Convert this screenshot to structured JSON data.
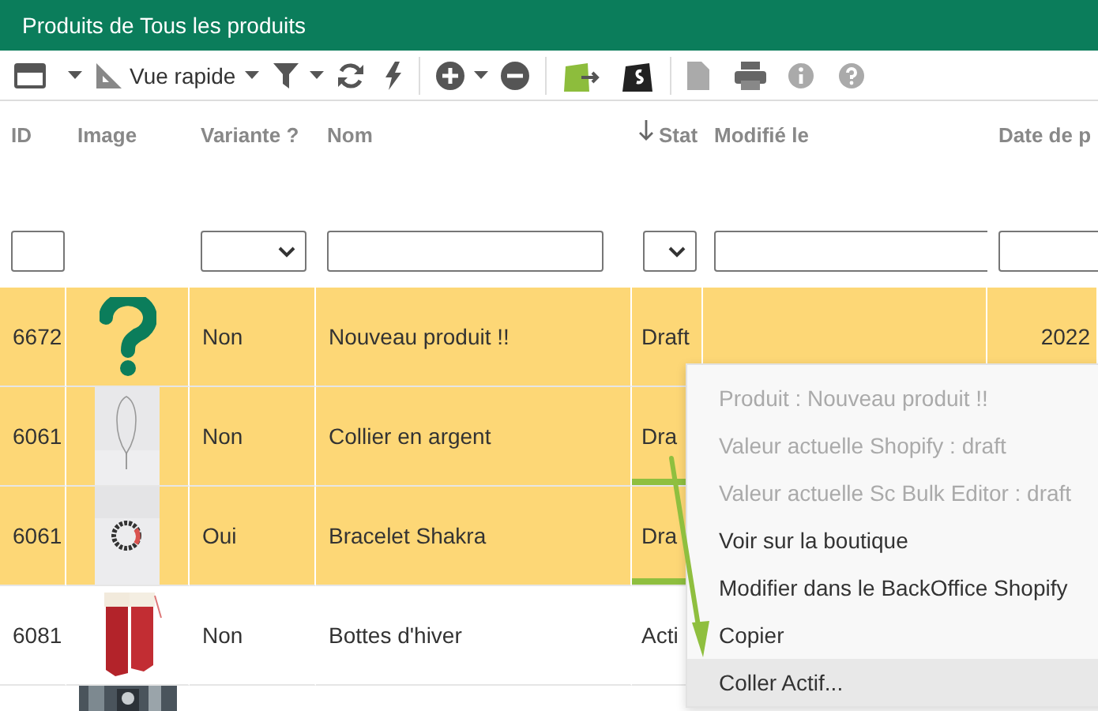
{
  "window": {
    "title": "Produits de Tous les produits"
  },
  "toolbar": {
    "view_label": "Vue rapide"
  },
  "columns": [
    {
      "label": "ID",
      "filter": {
        "kind": "text"
      },
      "sorted": false
    },
    {
      "label": "Image",
      "filter": {
        "kind": "none"
      },
      "sorted": false
    },
    {
      "label": "Variante ?",
      "filter": {
        "kind": "select"
      },
      "sorted": false
    },
    {
      "label": "Nom",
      "filter": {
        "kind": "text"
      },
      "sorted": false
    },
    {
      "label": "Stat",
      "filter": {
        "kind": "select"
      },
      "sorted": true
    },
    {
      "label": "Modifié le",
      "filter": {
        "kind": "text"
      },
      "sorted": false
    },
    {
      "label": "Date de p",
      "filter": {
        "kind": "text"
      },
      "sorted": false
    }
  ],
  "rows": [
    {
      "id": "6672",
      "image": {
        "kind": "placeholder"
      },
      "variant": "Non",
      "name": "Nouveau produit !!",
      "status": "Draft",
      "date": "2022",
      "selected": true,
      "marked": false
    },
    {
      "id": "6061",
      "image": {
        "kind": "necklace"
      },
      "variant": "Non",
      "name": "Collier en argent",
      "status": "Dra",
      "selected": true,
      "marked": true
    },
    {
      "id": "6061",
      "image": {
        "kind": "bracelet"
      },
      "variant": "Oui",
      "name": "Bracelet Shakra",
      "status": "Dra",
      "selected": true,
      "marked": true
    },
    {
      "id": "6081",
      "image": {
        "kind": "boots"
      },
      "variant": "Non",
      "name": "Bottes d'hiver",
      "status": "Acti",
      "selected": false,
      "marked": false
    },
    {
      "image": {
        "kind": "dark"
      },
      "selected": false,
      "marked": false
    }
  ],
  "context_menu": {
    "items": [
      {
        "label": "Produit : Nouveau produit !!",
        "disabled": true,
        "selected": false
      },
      {
        "label": "Valeur actuelle Shopify : draft",
        "disabled": true,
        "selected": false
      },
      {
        "label": "Valeur actuelle Sc Bulk Editor : draft",
        "disabled": true,
        "selected": false
      },
      {
        "label": "Voir sur la boutique",
        "disabled": false,
        "selected": false
      },
      {
        "label": "Modifier dans le BackOffice Shopify",
        "disabled": false,
        "selected": false
      },
      {
        "label": "Copier",
        "disabled": false,
        "selected": false
      },
      {
        "label": "Coller Actif...",
        "disabled": false,
        "selected": true
      }
    ]
  }
}
